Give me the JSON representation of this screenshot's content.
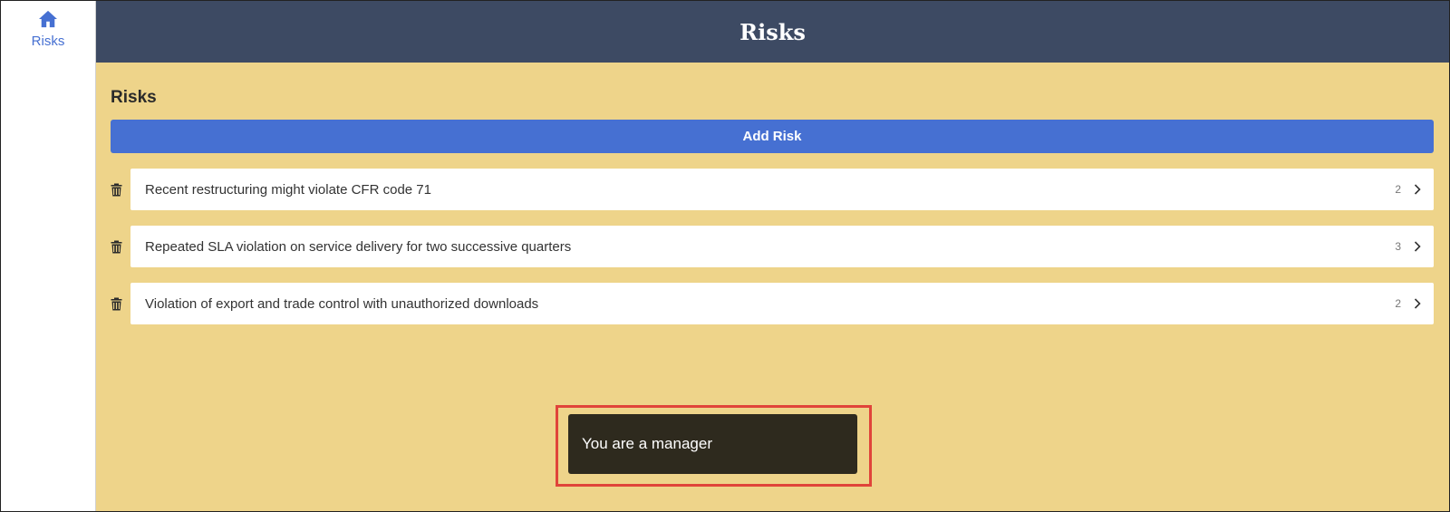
{
  "sidebar": {
    "items": [
      {
        "label": "Risks",
        "icon": "home-icon"
      }
    ]
  },
  "header": {
    "title": "Risks"
  },
  "main": {
    "section_title": "Risks",
    "add_button_label": "Add Risk",
    "risks": [
      {
        "text": "Recent restructuring might violate CFR code 71",
        "count": "2"
      },
      {
        "text": "Repeated SLA violation on service delivery for two successive quarters",
        "count": "3"
      },
      {
        "text": "Violation of export and trade control with unauthorized downloads",
        "count": "2"
      }
    ]
  },
  "toast": {
    "message": "You are a manager"
  },
  "colors": {
    "accent": "#4670d2",
    "header_bg": "#3d4a63",
    "content_bg": "#eed48a",
    "toast_bg": "#2e2a1e",
    "highlight": "#e0443a"
  }
}
